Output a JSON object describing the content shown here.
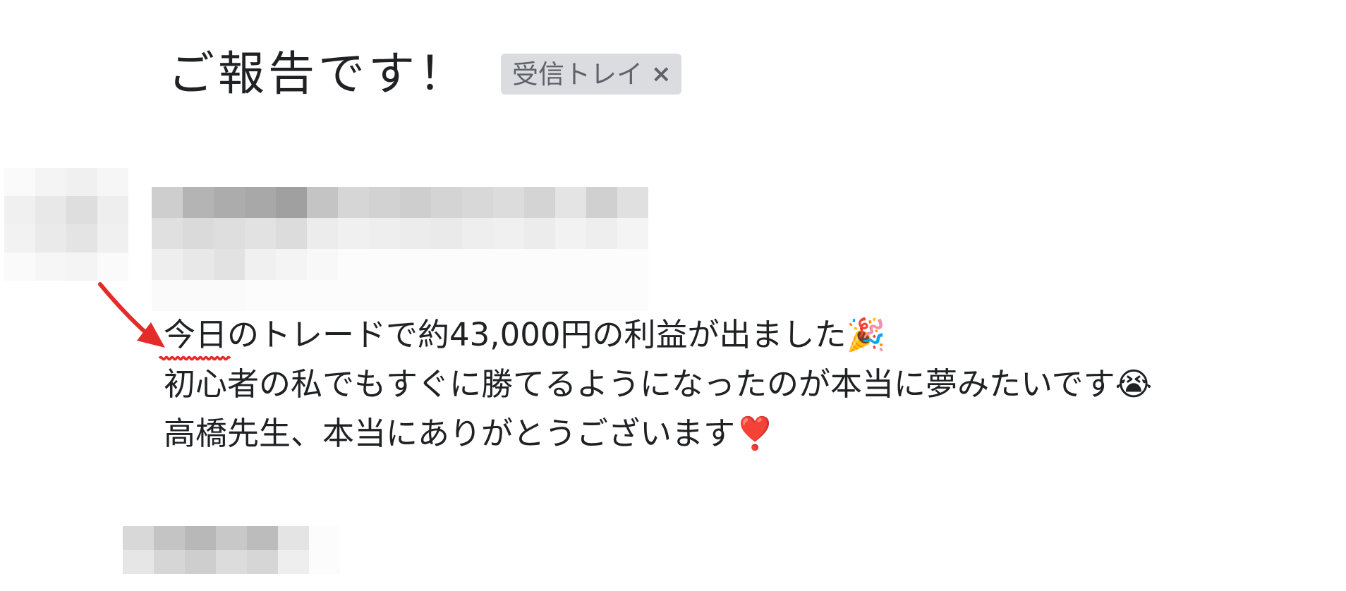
{
  "header": {
    "subject": "ご報告です！",
    "label_chip": {
      "text": "受信トレイ",
      "close_glyph": "×"
    }
  },
  "message": {
    "lines": [
      {
        "text": "今日のトレードで約43,000円の利益が出ました",
        "emoji": "🎉",
        "emoji_icon": "party-popper-icon",
        "highlighted": true
      },
      {
        "text": "初心者の私でもすぐに勝てるようになったのが本当に夢みたいです",
        "emoji": "😭",
        "emoji_icon": "crying-face-icon",
        "highlighted": false
      },
      {
        "text": "高橋先生、本当にありがとうございます",
        "emoji": "❣️",
        "emoji_icon": "heart-exclamation-icon",
        "highlighted": false
      }
    ]
  },
  "annotation": {
    "color": "#e52a2a",
    "arrow_icon": "red-arrow-icon"
  },
  "colors": {
    "label_chip_bg": "#dadce0",
    "text": "#202124",
    "muted_text": "#5f6368"
  }
}
